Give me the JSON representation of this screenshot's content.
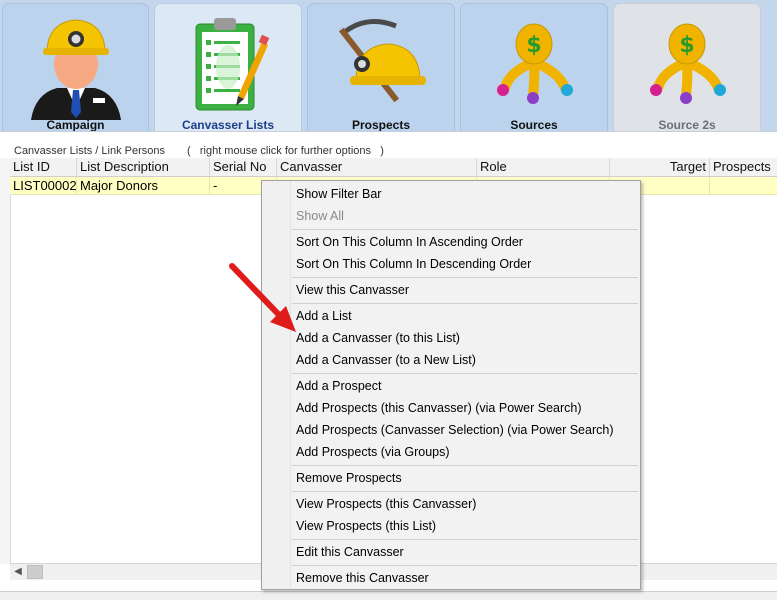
{
  "tabs": [
    {
      "label": "Campaign",
      "icon": "miner-person-icon"
    },
    {
      "label": "Canvasser Lists",
      "icon": "clipboard-checklist-icon",
      "active": true
    },
    {
      "label": "Prospects",
      "icon": "pickaxe-helmet-icon"
    },
    {
      "label": "Sources",
      "icon": "money-bag-icon"
    },
    {
      "label": "Source 2s",
      "icon": "money-bag-icon"
    }
  ],
  "panel": {
    "caption": "Canvasser Lists / Link Persons",
    "hint": "(   right mouse click for further options   )"
  },
  "grid": {
    "columns": [
      "List ID",
      "List Description",
      "Serial No",
      "Canvasser",
      "Role",
      "Target",
      "Prospects"
    ],
    "rows": [
      {
        "list_id": "LIST00002",
        "list_description": "Major Donors",
        "serial_no": "-",
        "canvasser": "",
        "role": "",
        "target": "",
        "prospects": ""
      }
    ]
  },
  "menu": {
    "items": [
      "Show Filter Bar",
      "Show All",
      "Sort On This Column In Ascending Order",
      "Sort On This Column In Descending Order",
      "View this Canvasser",
      "Add a List",
      "Add a Canvasser (to this List)",
      "Add a Canvasser (to a New List)",
      "Add a Prospect",
      "Add Prospects (this Canvasser) (via Power Search)",
      "Add Prospects (Canvasser Selection) (via Power Search)",
      "Add Prospects (via Groups)",
      "Remove Prospects",
      "View Prospects (this Canvasser)",
      "View Prospects (this List)",
      "Edit this Canvasser",
      "Remove this Canvasser"
    ],
    "disabled_items": [
      "Show All"
    ]
  },
  "colors": {
    "tab_bar": "#c3d6ec",
    "active_tab_label": "#1b3f8b",
    "selected_row": "#ffffc4",
    "annotation_arrow": "#e01b1b"
  }
}
